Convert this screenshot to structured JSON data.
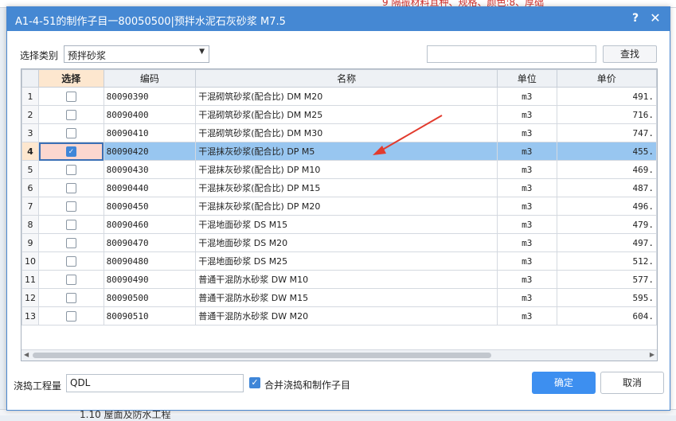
{
  "dialog": {
    "title": "A1-4-51的制作子目一80050500|预拌水泥石灰砂浆  M7.5",
    "help_label": "?",
    "close_label": "✕"
  },
  "filter": {
    "category_label": "选择类别",
    "category_value": "预拌砂浆",
    "search_value": "",
    "search_button": "查找"
  },
  "grid": {
    "columns": [
      "",
      "选择",
      "编码",
      "名称",
      "单位",
      "单价"
    ],
    "selected_row_index": 3,
    "rows": [
      {
        "num": "1",
        "checked": false,
        "code": "80090390",
        "name": "干混砌筑砂浆(配合比) DM M20",
        "unit": "m3",
        "price": "491."
      },
      {
        "num": "2",
        "checked": false,
        "code": "80090400",
        "name": "干混砌筑砂浆(配合比) DM M25",
        "unit": "m3",
        "price": "716."
      },
      {
        "num": "3",
        "checked": false,
        "code": "80090410",
        "name": "干混砌筑砂浆(配合比) DM M30",
        "unit": "m3",
        "price": "747."
      },
      {
        "num": "4",
        "checked": true,
        "code": "80090420",
        "name": "干混抹灰砂浆(配合比) DP M5",
        "unit": "m3",
        "price": "455."
      },
      {
        "num": "5",
        "checked": false,
        "code": "80090430",
        "name": "干混抹灰砂浆(配合比) DP M10",
        "unit": "m3",
        "price": "469."
      },
      {
        "num": "6",
        "checked": false,
        "code": "80090440",
        "name": "干混抹灰砂浆(配合比) DP M15",
        "unit": "m3",
        "price": "487."
      },
      {
        "num": "7",
        "checked": false,
        "code": "80090450",
        "name": "干混抹灰砂浆(配合比) DP M20",
        "unit": "m3",
        "price": "496."
      },
      {
        "num": "8",
        "checked": false,
        "code": "80090460",
        "name": "干混地面砂浆 DS M15",
        "unit": "m3",
        "price": "479."
      },
      {
        "num": "9",
        "checked": false,
        "code": "80090470",
        "name": "干混地面砂浆 DS M20",
        "unit": "m3",
        "price": "497."
      },
      {
        "num": "10",
        "checked": false,
        "code": "80090480",
        "name": "干混地面砂浆 DS M25",
        "unit": "m3",
        "price": "512."
      },
      {
        "num": "11",
        "checked": false,
        "code": "80090490",
        "name": "普通干混防水砂浆 DW M10",
        "unit": "m3",
        "price": "577."
      },
      {
        "num": "12",
        "checked": false,
        "code": "80090500",
        "name": "普通干混防水砂浆 DW M15",
        "unit": "m3",
        "price": "595."
      },
      {
        "num": "13",
        "checked": false,
        "code": "80090510",
        "name": "普通干混防水砂浆 DW M20",
        "unit": "m3",
        "price": "604."
      }
    ]
  },
  "footer": {
    "quantity_label": "浇捣工程量",
    "quantity_value": "QDL",
    "merge_checked": true,
    "merge_label": "合并浇捣和制作子目",
    "ok_label": "确定",
    "cancel_label": "取消"
  },
  "background": {
    "top_fragment": "9 隔振材料且种、规格、颜色:8、厚础",
    "bottom_fragment": "1.10 屋面及防水工程"
  },
  "colors": {
    "titlebar": "#4588d3",
    "selected_row": "#98c6f0",
    "primary_button": "#3d8ff0",
    "annotation_arrow": "#e23b2e"
  }
}
